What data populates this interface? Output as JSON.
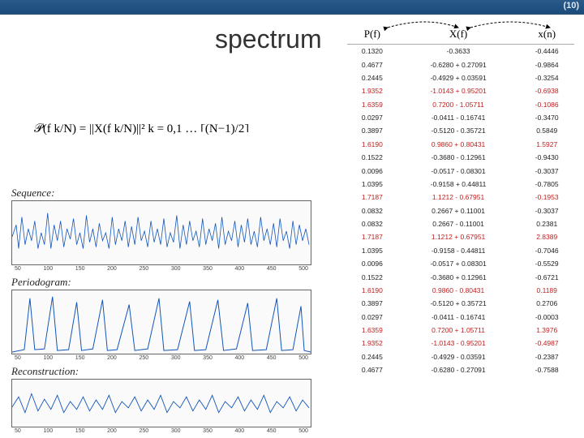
{
  "slide_number": "(10)",
  "title": "spectrum",
  "formula_html": "𝒫(f k/N) = ||X(f k/N)||²   k = 0,1 … ⌈(N−1)/2⌉",
  "labels": {
    "sequence": "Sequence:",
    "periodogram": "Periodogram:",
    "reconstruction": "Reconstruction:"
  },
  "table": {
    "headers": [
      "P(f)",
      "X(f)",
      "x(n)"
    ],
    "rows": [
      {
        "r": false,
        "c": [
          "0.1320",
          "-0.3633",
          "-0.4446"
        ]
      },
      {
        "r": false,
        "c": [
          "0.4677",
          "-0.6280 + 0.27091",
          "-0.9864"
        ]
      },
      {
        "r": false,
        "c": [
          "0.2445",
          "-0.4929 + 0.03591",
          "-0.3254"
        ]
      },
      {
        "r": true,
        "c": [
          "1.9352",
          "-1.0143 + 0.95201",
          "-0.6938"
        ]
      },
      {
        "r": true,
        "c": [
          "1.6359",
          "0.7200 - 1.05711",
          "-0.1086"
        ]
      },
      {
        "r": false,
        "c": [
          "0.0297",
          "-0.0411 - 0.16741",
          "-0.3470"
        ]
      },
      {
        "r": false,
        "c": [
          "0.3897",
          "-0.5120 - 0.35721",
          "0.5849"
        ]
      },
      {
        "r": true,
        "c": [
          "1.6190",
          "0.9860 + 0.80431",
          "1.5927"
        ]
      },
      {
        "r": false,
        "c": [
          "0.1522",
          "-0.3680 - 0.12961",
          "-0.9430"
        ]
      },
      {
        "r": false,
        "c": [
          "0.0096",
          "-0.0517 - 0.08301",
          "-0.3037"
        ]
      },
      {
        "r": false,
        "c": [
          "1.0395",
          "-0.9158 + 0.44811",
          "-0.7805"
        ]
      },
      {
        "r": true,
        "c": [
          "1.7187",
          "1.1212 - 0.67951",
          "-0.1953"
        ]
      },
      {
        "r": false,
        "c": [
          "0.0832",
          "0.2667 + 0.11001",
          "-0.3037"
        ]
      },
      {
        "r": false,
        "c": [
          "0.0832",
          "0.2667 - 0.11001",
          "0.2381"
        ]
      },
      {
        "r": true,
        "c": [
          "1.7187",
          "1.1212 + 0.67951",
          "2.8389"
        ]
      },
      {
        "r": false,
        "c": [
          "1.0395",
          "-0.9158 - 0.44811",
          "-0.7046"
        ]
      },
      {
        "r": false,
        "c": [
          "0.0096",
          "-0.0517 + 0.08301",
          "-0.5529"
        ]
      },
      {
        "r": false,
        "c": [
          "0.1522",
          "-0.3680 + 0.12961",
          "-0.6721"
        ]
      },
      {
        "r": true,
        "c": [
          "1.6190",
          "0.9860 - 0.80431",
          "0.1189"
        ]
      },
      {
        "r": false,
        "c": [
          "0.3897",
          "-0.5120 + 0.35721",
          "0.2706"
        ]
      },
      {
        "r": false,
        "c": [
          "0.0297",
          "-0.0411 - 0.16741",
          "-0.0003"
        ]
      },
      {
        "r": true,
        "c": [
          "1.6359",
          "0.7200 + 1.05711",
          "1.3976"
        ]
      },
      {
        "r": true,
        "c": [
          "1.9352",
          "-1.0143 - 0.95201",
          "-0.4987"
        ]
      },
      {
        "r": false,
        "c": [
          "0.2445",
          "-0.4929 - 0.03591",
          "-0.2387"
        ]
      },
      {
        "r": false,
        "c": [
          "0.4677",
          "-0.6280 - 0.27091",
          "-0.7588"
        ]
      }
    ]
  },
  "chart_data": [
    {
      "type": "line",
      "title": "Sequence",
      "x_range": [
        0,
        500
      ],
      "y_range": [
        -2,
        3
      ],
      "xticks": [
        "50",
        "100",
        "150",
        "200",
        "250",
        "300",
        "350",
        "400",
        "450",
        "500"
      ],
      "note": "Noisy time-domain signal with ~10 bursts"
    },
    {
      "type": "line",
      "title": "Periodogram",
      "x_range": [
        0,
        500
      ],
      "y_range": [
        0,
        2
      ],
      "xticks": [
        "50",
        "100",
        "150",
        "200",
        "250",
        "300",
        "350",
        "400",
        "450",
        "500"
      ],
      "peaks_approx_x": [
        30,
        60,
        100,
        140,
        180,
        230,
        280,
        320,
        370,
        420,
        460
      ],
      "note": "Power spectrum with narrow peaks reaching ~1.5–2.0"
    },
    {
      "type": "line",
      "title": "Reconstruction",
      "x_range": [
        0,
        500
      ],
      "y_range": [
        -2,
        3
      ],
      "xticks": [
        "50",
        "100",
        "150",
        "200",
        "250",
        "300",
        "350",
        "400",
        "450",
        "500"
      ],
      "note": "Smoothed reconstruction tracking Sequence envelope"
    }
  ]
}
